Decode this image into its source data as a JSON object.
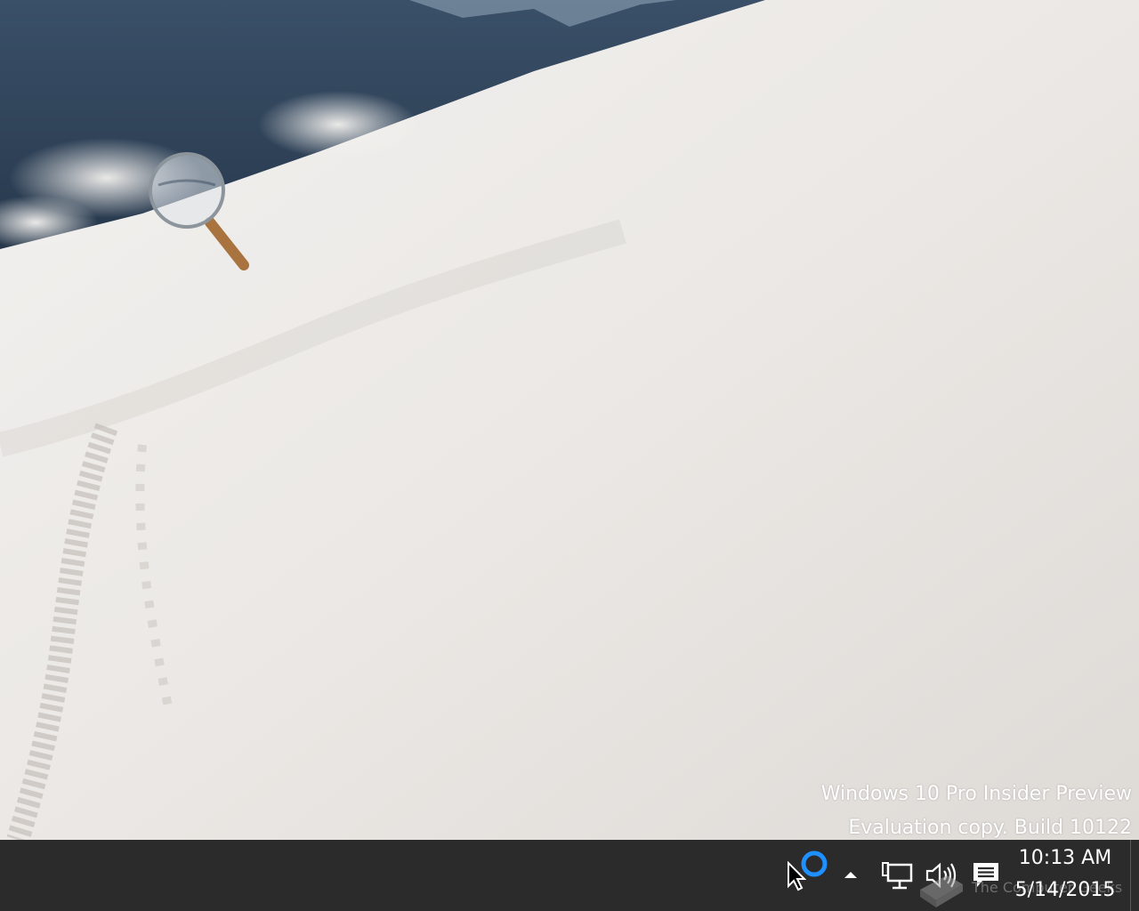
{
  "desktop": {
    "watermark": {
      "line1": "Windows 10 Pro Insider Preview",
      "line2": "Evaluation copy. Build 10122"
    }
  },
  "taskbar": {
    "clock": {
      "time": "10:13 AM",
      "date": "5/14/2015"
    },
    "tray_icons": [
      "cortana-ring-icon",
      "chevron-up-icon",
      "network-icon",
      "volume-icon",
      "action-center-icon"
    ],
    "site_watermark": "The Computer Geeks"
  },
  "colors": {
    "taskbar": "#2b2b2b",
    "cortana_blue": "#1e90ff",
    "text": "#ffffff"
  }
}
